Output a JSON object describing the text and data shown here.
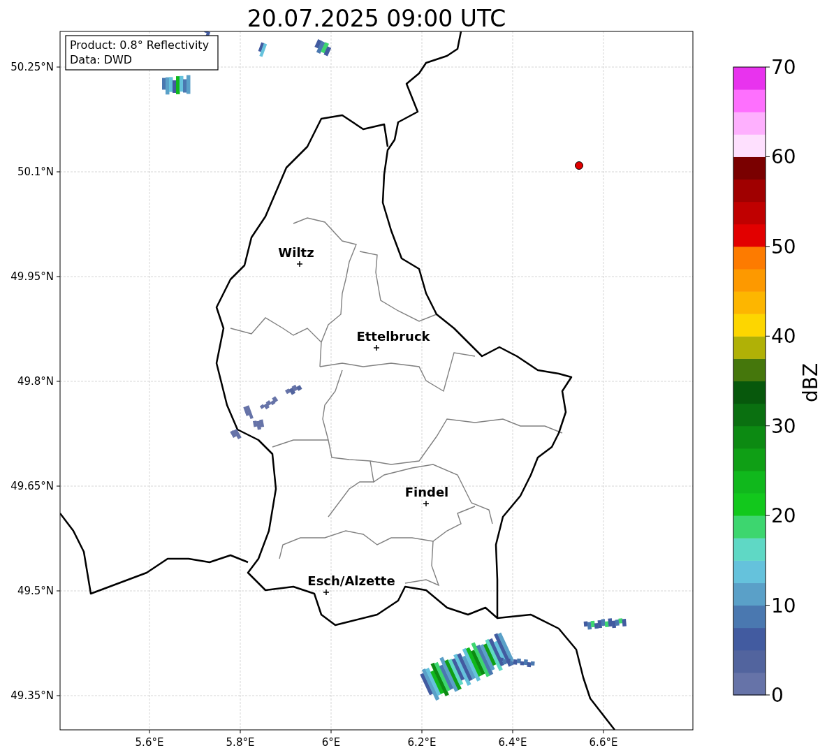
{
  "title": "20.07.2025 09:00 UTC",
  "info_box": [
    "Product: 0.8° Reflectivity",
    "Data: DWD"
  ],
  "map": {
    "cities": [
      {
        "name": "Wiltz"
      },
      {
        "name": "Ettelbruck"
      },
      {
        "name": "Findel"
      },
      {
        "name": "Esch/Alzette"
      }
    ]
  },
  "x_ticks": [
    "5.6°E",
    "5.8°E",
    "6°E",
    "6.2°E",
    "6.4°E",
    "6.6°E"
  ],
  "y_ticks": [
    "50.25°N",
    "50.1°N",
    "49.95°N",
    "49.8°N",
    "49.65°N",
    "49.5°N",
    "49.35°N"
  ],
  "colorbar": {
    "label": "dBZ",
    "ticks": [
      "70",
      "60",
      "50",
      "40",
      "30",
      "20",
      "10",
      "0"
    ],
    "bands": [
      {
        "color": "#6673a8"
      },
      {
        "color": "#52649e"
      },
      {
        "color": "#425ba0"
      },
      {
        "color": "#4a78b0"
      },
      {
        "color": "#5aa0c8"
      },
      {
        "color": "#65c2dc"
      },
      {
        "color": "#5fd8c5"
      },
      {
        "color": "#3dd66f"
      },
      {
        "color": "#12c81c"
      },
      {
        "color": "#10b81c"
      },
      {
        "color": "#0f9f15"
      },
      {
        "color": "#0c8a12"
      },
      {
        "color": "#0a7010"
      },
      {
        "color": "#07580c"
      },
      {
        "color": "#45770c"
      },
      {
        "color": "#b0b106"
      },
      {
        "color": "#fdd600"
      },
      {
        "color": "#fdb600"
      },
      {
        "color": "#fd9900"
      },
      {
        "color": "#fd7b00"
      },
      {
        "color": "#e20000"
      },
      {
        "color": "#c00000"
      },
      {
        "color": "#a00000"
      },
      {
        "color": "#7a0000"
      },
      {
        "color": "#fee0fe"
      },
      {
        "color": "#feb0fe"
      },
      {
        "color": "#fe70fe"
      },
      {
        "color": "#e833ee"
      }
    ]
  }
}
